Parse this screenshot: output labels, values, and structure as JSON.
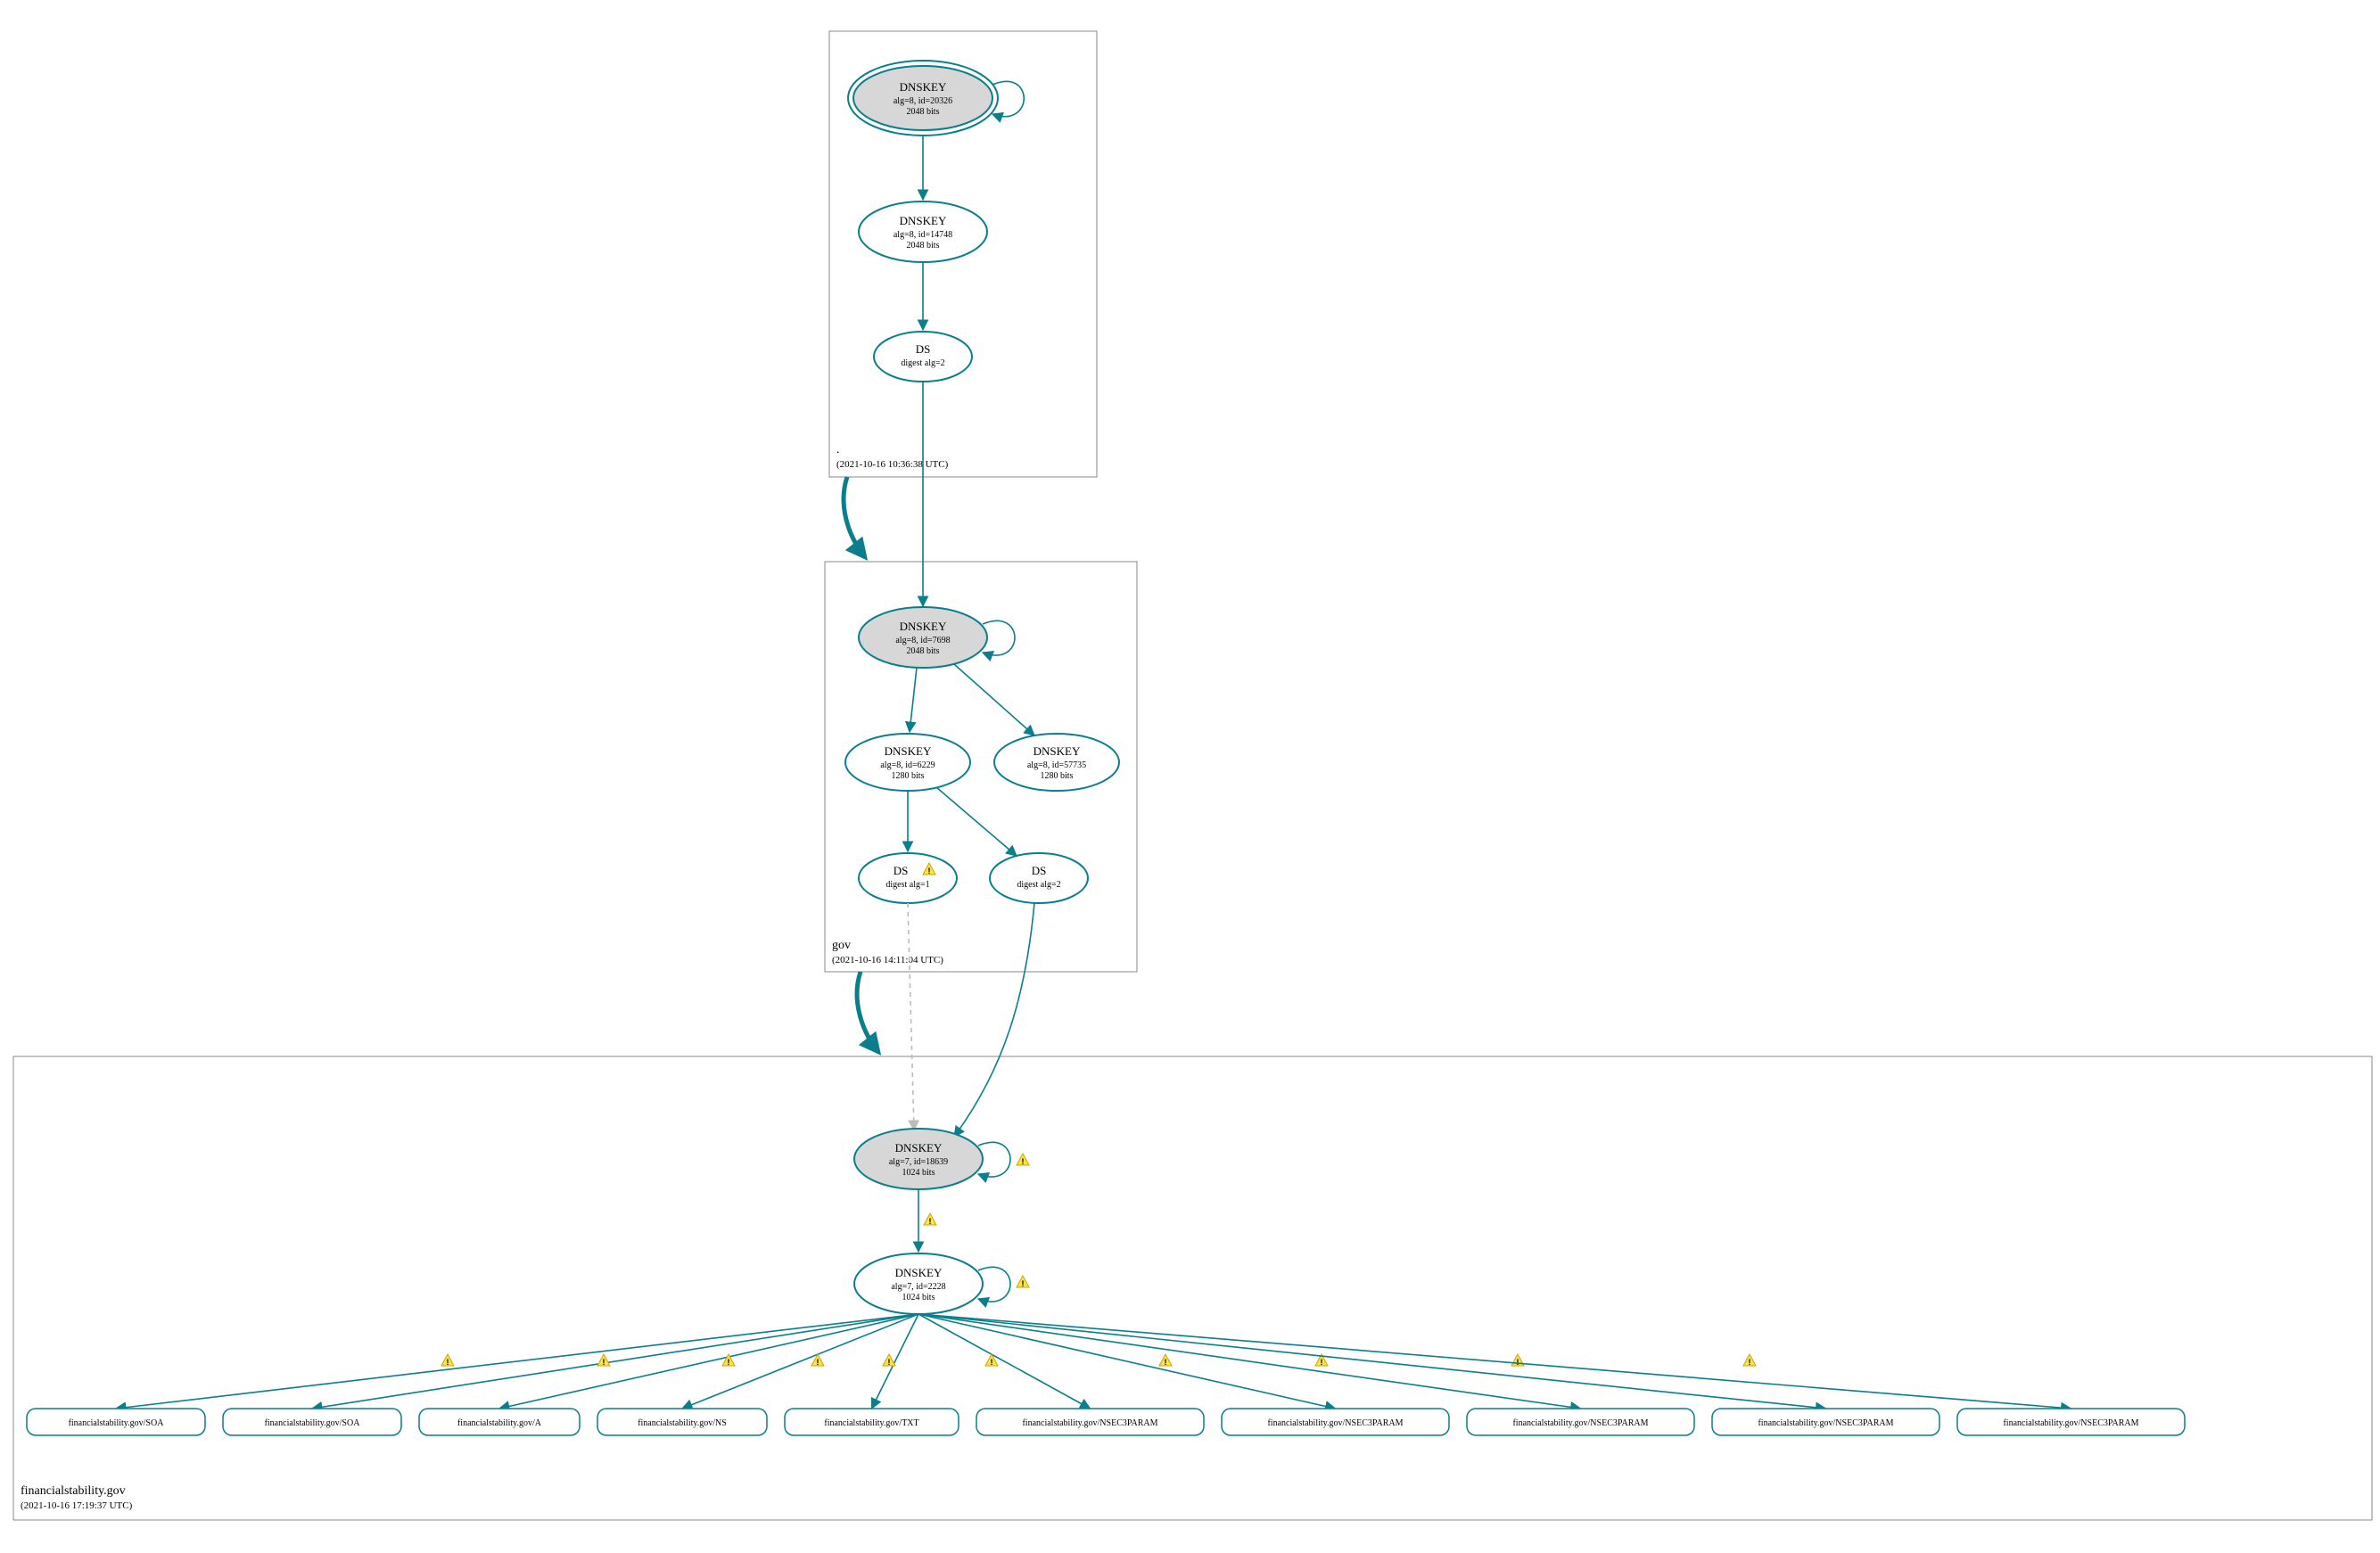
{
  "zones": {
    "root": {
      "label": ".",
      "timestamp": "(2021-10-16 10:36:38 UTC)",
      "nodes": {
        "ksk": {
          "title": "DNSKEY",
          "line1": "alg=8, id=20326",
          "line2": "2048 bits"
        },
        "zsk": {
          "title": "DNSKEY",
          "line1": "alg=8, id=14748",
          "line2": "2048 bits"
        },
        "ds": {
          "title": "DS",
          "line1": "digest alg=2"
        }
      }
    },
    "gov": {
      "label": "gov",
      "timestamp": "(2021-10-16 14:11:04 UTC)",
      "nodes": {
        "ksk": {
          "title": "DNSKEY",
          "line1": "alg=8, id=7698",
          "line2": "2048 bits"
        },
        "zsk1": {
          "title": "DNSKEY",
          "line1": "alg=8, id=6229",
          "line2": "1280 bits"
        },
        "zsk2": {
          "title": "DNSKEY",
          "line1": "alg=8, id=57735",
          "line2": "1280 bits"
        },
        "ds1": {
          "title": "DS",
          "line1": "digest alg=1"
        },
        "ds2": {
          "title": "DS",
          "line1": "digest alg=2"
        }
      }
    },
    "fs": {
      "label": "financialstability.gov",
      "timestamp": "(2021-10-16 17:19:37 UTC)",
      "nodes": {
        "ksk": {
          "title": "DNSKEY",
          "line1": "alg=7, id=18639",
          "line2": "1024 bits"
        },
        "zsk": {
          "title": "DNSKEY",
          "line1": "alg=7, id=2228",
          "line2": "1024 bits"
        }
      },
      "rrsets": [
        "financialstability.gov/SOA",
        "financialstability.gov/SOA",
        "financialstability.gov/A",
        "financialstability.gov/NS",
        "financialstability.gov/TXT",
        "financialstability.gov/NSEC3PARAM",
        "financialstability.gov/NSEC3PARAM",
        "financialstability.gov/NSEC3PARAM",
        "financialstability.gov/NSEC3PARAM",
        "financialstability.gov/NSEC3PARAM"
      ]
    }
  }
}
